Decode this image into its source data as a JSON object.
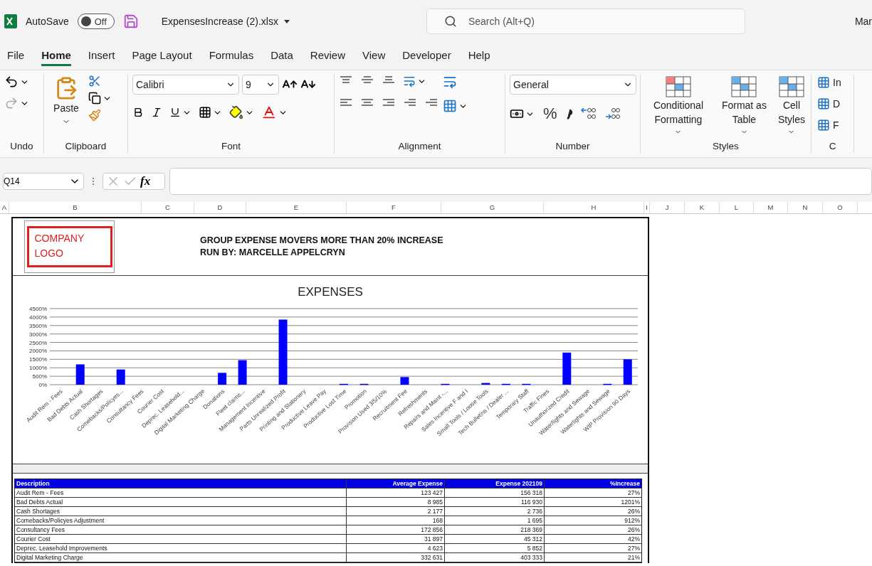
{
  "title_bar": {
    "autosave_label": "AutoSave",
    "autosave": {
      "on": false,
      "label": "Off"
    },
    "file_name": "ExpensesIncrease (2).xlsx",
    "search": {
      "placeholder": "Search (Alt+Q)"
    },
    "user": "Mar"
  },
  "menu_tabs": [
    {
      "label": "File",
      "selected": false
    },
    {
      "label": "Home",
      "selected": true
    },
    {
      "label": "Insert",
      "selected": false
    },
    {
      "label": "Page Layout",
      "selected": false
    },
    {
      "label": "Formulas",
      "selected": false
    },
    {
      "label": "Data",
      "selected": false
    },
    {
      "label": "Review",
      "selected": false
    },
    {
      "label": "View",
      "selected": false
    },
    {
      "label": "Developer",
      "selected": false
    },
    {
      "label": "Help",
      "selected": false
    }
  ],
  "ribbon": {
    "groups": [
      {
        "kind": "undo",
        "label": "Undo"
      },
      {
        "kind": "clipboard",
        "label": "Clipboard",
        "paste": "Paste"
      },
      {
        "kind": "font",
        "label": "Font",
        "font": "Calibri",
        "size": "9"
      },
      {
        "kind": "alignment",
        "label": "Alignment"
      },
      {
        "kind": "number",
        "label": "Number",
        "format": "General",
        "percent": "%"
      },
      {
        "kind": "styles",
        "label": "Styles",
        "buttons": [
          "Conditional Formatting",
          "Format as Table",
          "Cell Styles"
        ]
      },
      {
        "kind": "cells",
        "label": "C",
        "buttons": [
          "In",
          "D",
          "F"
        ]
      }
    ]
  },
  "formula_bar": {
    "name_box": "Q14",
    "function_label": "fx"
  },
  "columns": [
    {
      "label": "A"
    },
    {
      "label": "B"
    },
    {
      "label": "C"
    },
    {
      "label": "D"
    },
    {
      "label": "E"
    },
    {
      "label": "F"
    },
    {
      "label": "G"
    },
    {
      "label": "H"
    },
    {
      "label": "I"
    },
    {
      "label": "J"
    },
    {
      "label": "K"
    },
    {
      "label": "L"
    },
    {
      "label": "M"
    },
    {
      "label": "N"
    },
    {
      "label": "O"
    }
  ],
  "report": {
    "logo": "COMPANY LOGO",
    "heading": "GROUP EXPENSE MOVERS MORE THAN 20% INCREASE",
    "run_by": "RUN BY: MARCELLE APPELCRYN",
    "chart_data": {
      "type": "bar",
      "title": "EXPENSES",
      "categories": [
        "Audit Rem - Fees",
        "Bad Debts Actual",
        "Cash Shortages",
        "Comebacks/Policyes...",
        "Consultancy Fees",
        "Courier Cost",
        "Deprec. Leasehold...",
        "Digital Marketing Charge",
        "Donations",
        "Fleet claims...",
        "Management Incentive",
        "Parts Unrealized Profit",
        "Printing  and Stationery",
        "Productive Leave Pay",
        "Productive Lost Time",
        "Promotion",
        "Provision Used 3/5/10%",
        "Recruitment Fee",
        "Refreshments",
        "Repairs  and Maint -...",
        "Sales Incentive F and I",
        "Small Tools / Loose Tools",
        "Tech Bulletins / Dealer ...",
        "Temporary Staff",
        "Traffic Fines",
        "Unauthorized Credit",
        "Water/lights  and Sewage",
        "Waterlights and Sewage",
        "WIP Provision 90 Days"
      ],
      "series": [
        {
          "color": "#0000ff",
          "values": [
            0,
            1200,
            0,
            900,
            0,
            0,
            0,
            0,
            700,
            1450,
            0,
            3850,
            0,
            0,
            50,
            50,
            0,
            450,
            0,
            50,
            0,
            100,
            50,
            50,
            0,
            1900,
            0,
            50,
            1500
          ]
        }
      ],
      "grid": true,
      "ylim": [
        0,
        4500
      ],
      "yticks": [
        {
          "value": 0,
          "label": "0%"
        },
        {
          "value": 500,
          "label": "500%"
        },
        {
          "value": 1000,
          "label": "1000%"
        },
        {
          "value": 1500,
          "label": "1500%"
        },
        {
          "value": 2000,
          "label": "2000%"
        },
        {
          "value": 2500,
          "label": "2500%"
        },
        {
          "value": 3000,
          "label": "3000%"
        },
        {
          "value": 3500,
          "label": "3500%"
        },
        {
          "value": 4000,
          "label": "4000%"
        },
        {
          "value": 4500,
          "label": "4500%"
        }
      ]
    },
    "table": {
      "columns": [
        "Description",
        "Average Expense",
        "Expense 202109",
        "%Increase"
      ],
      "rows": [
        [
          "Audit Rem - Fees",
          "123 427",
          "156 318",
          "27%"
        ],
        [
          "Bad Debts Actual",
          "8 985",
          "116 930",
          "1201%"
        ],
        [
          "Cash Shortages",
          "2 177",
          "2 736",
          "26%"
        ],
        [
          "Comebacks/Policyes Adjustment",
          "168",
          "1 695",
          "912%"
        ],
        [
          "Consultancy Fees",
          "172 856",
          "218 369",
          "26%"
        ],
        [
          "Courier Cost",
          "31 897",
          "45 312",
          "42%"
        ],
        [
          "Deprec. Leasehold Improvements",
          "4 623",
          "5 852",
          "27%"
        ],
        [
          "Digital Marketing Charge",
          "332 631",
          "403 333",
          "21%"
        ]
      ]
    }
  }
}
